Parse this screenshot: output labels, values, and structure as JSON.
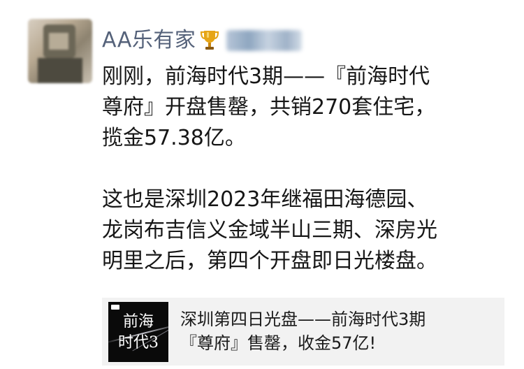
{
  "post": {
    "author": "AA乐有家",
    "author_icon": "trophy-icon",
    "name_color": "#55627a",
    "paragraphs": [
      [
        "刚刚，前海时代3期——『前海时代",
        "尊府』开盘售罄，共销270套住宅，",
        "揽金57.38亿。"
      ],
      [
        "这也是深圳2023年继福田海德园、",
        "龙岗布吉信义金域半山三期、深房光",
        "明里之后，第四个开盘即日光楼盘。"
      ]
    ]
  },
  "link_card": {
    "thumbnail_lines": [
      "前海",
      "时代3"
    ],
    "title_lines": [
      "深圳第四日光盘——前海时代3期",
      "『尊府』售罄，收金57亿!"
    ]
  }
}
